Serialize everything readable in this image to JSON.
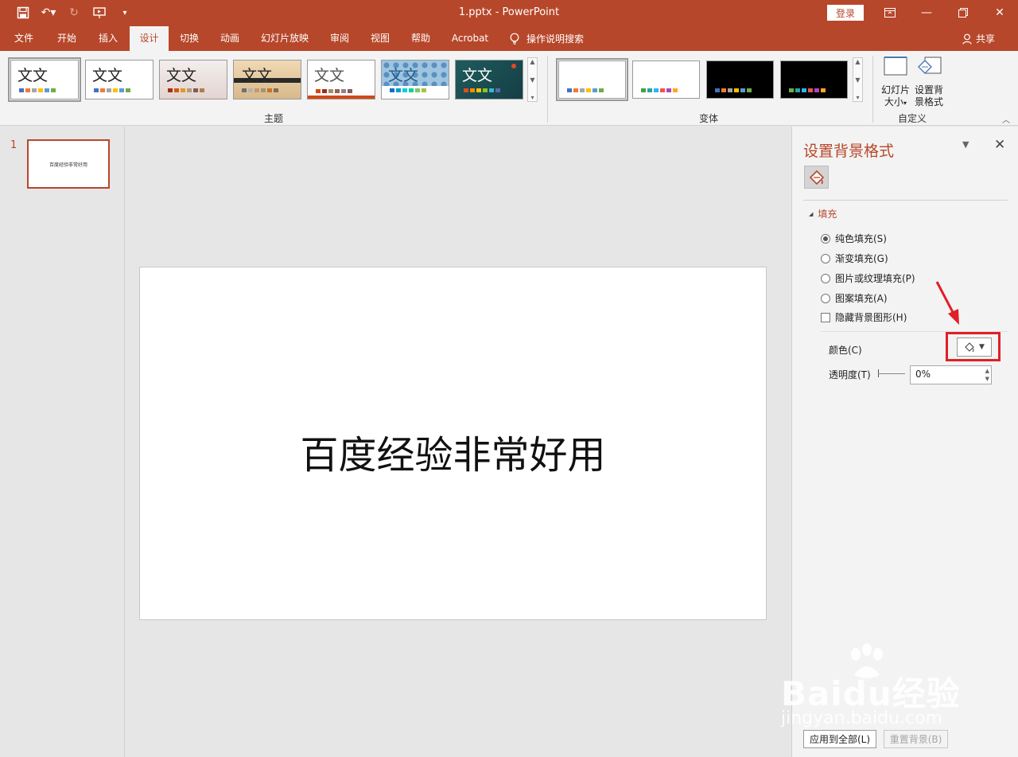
{
  "app": {
    "title": "1.pptx  -  PowerPoint",
    "login": "登录",
    "share": "共享"
  },
  "tabs": [
    "文件",
    "开始",
    "插入",
    "设计",
    "切换",
    "动画",
    "幻灯片放映",
    "审阅",
    "视图",
    "帮助",
    "Acrobat"
  ],
  "active_tab": "设计",
  "tell_me": "操作说明搜索",
  "ribbon": {
    "themes_label": "主题",
    "variants_label": "变体",
    "customize_label": "自定义",
    "theme_sample_text": "文文",
    "slide_size": "幻灯片大小",
    "format_background_button": "设置背景格式",
    "theme_colors": [
      [
        "#4472c4",
        "#ed7d31",
        "#a5a5a5",
        "#ffc000",
        "#5b9bd5",
        "#70ad47"
      ],
      [
        "#4472c4",
        "#ed7d31",
        "#a5a5a5",
        "#ffc000",
        "#5b9bd5",
        "#70ad47"
      ],
      [
        "#a5300f",
        "#d55816",
        "#e19825",
        "#b19c7d",
        "#7f5f52",
        "#b27d49"
      ],
      [
        "#6f6f74",
        "#b3b3b3",
        "#c3986d",
        "#a19574",
        "#c17529",
        "#826e54"
      ],
      [
        "#d34817",
        "#9b2d1f",
        "#a28e6a",
        "#956251",
        "#918485",
        "#855d5d"
      ],
      [
        "#0f6fc6",
        "#009dd9",
        "#0bd0d9",
        "#10cf9b",
        "#7cca62",
        "#a5c249"
      ],
      [
        "#e64823",
        "#ff8b00",
        "#f6c300",
        "#90c226",
        "#3ab7c9",
        "#5b6ba7"
      ]
    ],
    "variant_colors": [
      [
        "#4472c4",
        "#ed7d31",
        "#a5a5a5",
        "#ffc000",
        "#5b9bd5",
        "#70ad47"
      ],
      [
        "#43a047",
        "#26a69a",
        "#29b6f6",
        "#ef5350",
        "#ab47bc",
        "#ffa726"
      ],
      [
        "#4472c4",
        "#ed7d31",
        "#a5a5a5",
        "#ffc000",
        "#5b9bd5",
        "#70ad47"
      ],
      [
        "#70ad47",
        "#26a69a",
        "#29b6f6",
        "#ef5350",
        "#ab47bc",
        "#ffa726"
      ]
    ]
  },
  "thumbnail": {
    "number": "1",
    "text": "百度经验非常好用"
  },
  "slide": {
    "text": "百度经验非常好用"
  },
  "pane": {
    "title": "设置背景格式",
    "section": "填充",
    "options": [
      "纯色填充(S)",
      "渐变填充(G)",
      "图片或纹理填充(P)",
      "图案填充(A)"
    ],
    "selected_option": "纯色填充(S)",
    "hide_background_graphics": "隐藏背景图形(H)",
    "color_label": "颜色(C)",
    "transparency_label": "透明度(T)",
    "transparency_value": "0%",
    "apply_all": "应用到全部(L)",
    "reset_background": "重置背景(B)"
  },
  "watermark": {
    "brand": "Baidu经验",
    "url": "jingyan.baidu.com"
  },
  "colors": {
    "accent": "#b7472a",
    "highlight": "#e01f26"
  }
}
